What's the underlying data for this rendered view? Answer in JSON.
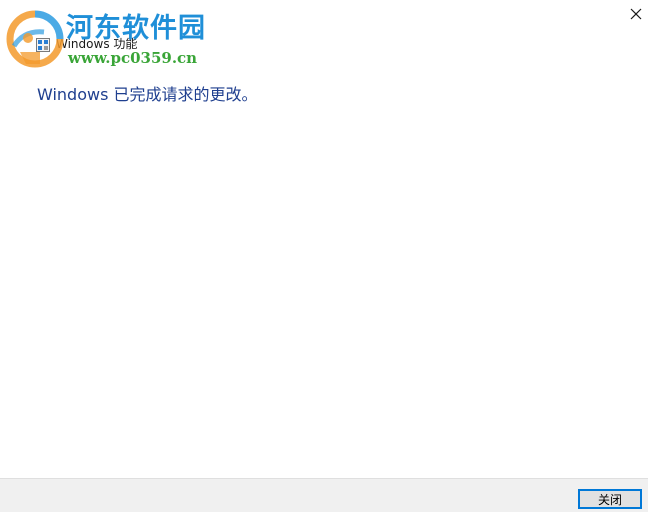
{
  "window": {
    "title": "Windows 功能",
    "close_icon": "close-icon"
  },
  "watermark": {
    "name": "河东软件园",
    "url": "www.pc0359.cn",
    "colors": {
      "name": "#1f8fd8",
      "url": "#3aa538"
    }
  },
  "content": {
    "message": "Windows 已完成请求的更改。"
  },
  "footer": {
    "close_label": "关闭"
  },
  "colors": {
    "message": "#1f3f8f",
    "button_border": "#0078d7",
    "footer_bg": "#f0f0f0"
  }
}
